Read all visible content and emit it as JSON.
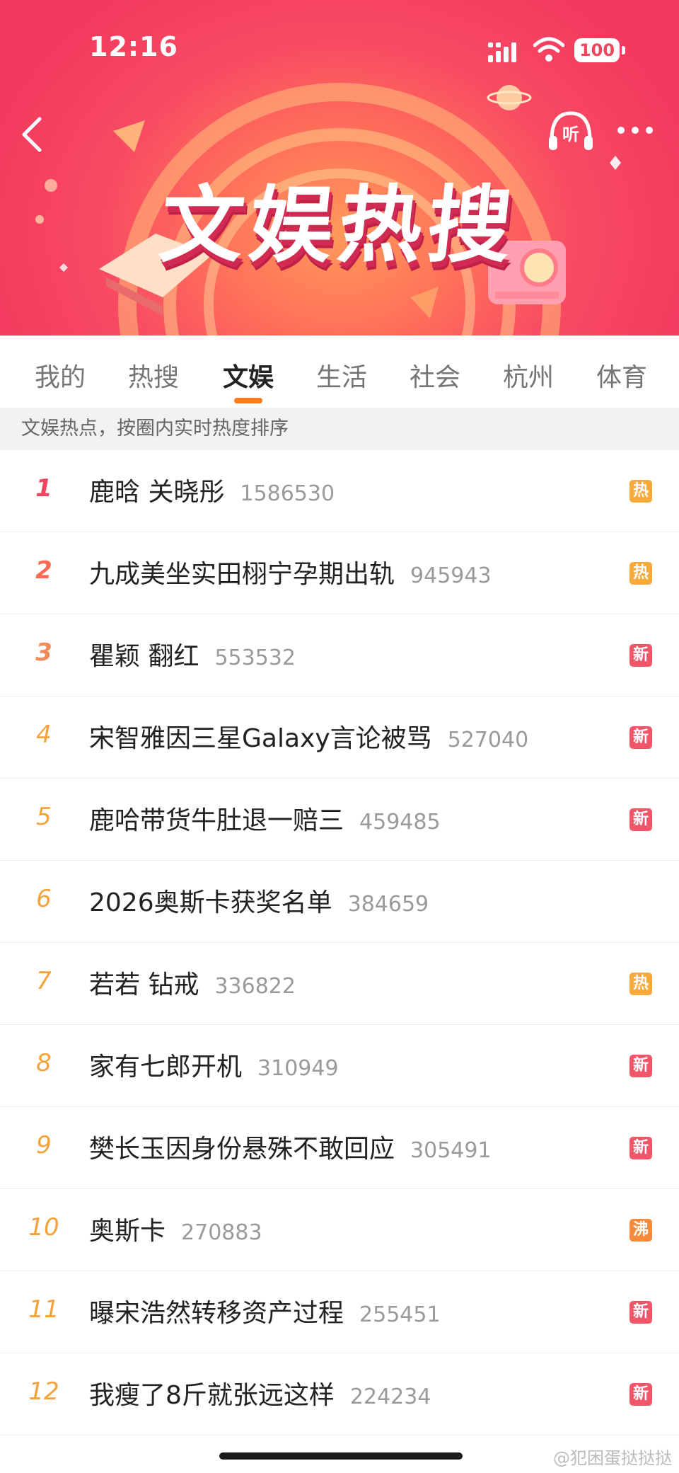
{
  "status_bar": {
    "time": "12:16",
    "battery": "100"
  },
  "header": {
    "title": "文娱热搜",
    "listen_label": "听"
  },
  "tabs": [
    {
      "label": "我的"
    },
    {
      "label": "热搜"
    },
    {
      "label": "文娱"
    },
    {
      "label": "生活"
    },
    {
      "label": "社会"
    },
    {
      "label": "杭州"
    },
    {
      "label": "体育"
    }
  ],
  "active_tab": "文娱",
  "subtitle": "文娱热点，按圈内实时热度排序",
  "items": [
    {
      "rank": "1",
      "title": "鹿晗 关晓彤",
      "count": "1586530",
      "badge": "热"
    },
    {
      "rank": "2",
      "title": "九成美坐实田栩宁孕期出轨",
      "count": "945943",
      "badge": "热"
    },
    {
      "rank": "3",
      "title": "瞿颖 翻红",
      "count": "553532",
      "badge": "新"
    },
    {
      "rank": "4",
      "title": "宋智雅因三星Galaxy言论被骂",
      "count": "527040",
      "badge": "新"
    },
    {
      "rank": "5",
      "title": "鹿哈带货牛肚退一赔三",
      "count": "459485",
      "badge": "新"
    },
    {
      "rank": "6",
      "title": "2026奥斯卡获奖名单",
      "count": "384659",
      "badge": ""
    },
    {
      "rank": "7",
      "title": "若若 钻戒",
      "count": "336822",
      "badge": "热"
    },
    {
      "rank": "8",
      "title": "家有七郎开机",
      "count": "310949",
      "badge": "新"
    },
    {
      "rank": "9",
      "title": "樊长玉因身份悬殊不敢回应",
      "count": "305491",
      "badge": "新"
    },
    {
      "rank": "10",
      "title": "奥斯卡",
      "count": "270883",
      "badge": "沸"
    },
    {
      "rank": "11",
      "title": "曝宋浩然转移资产过程",
      "count": "255451",
      "badge": "新"
    },
    {
      "rank": "12",
      "title": "我瘦了8斤就张远这样",
      "count": "224234",
      "badge": "新"
    }
  ],
  "watermark": "@犯困蛋挞挞挞",
  "colors": {
    "accent": "#ff7a1a",
    "hot": "#f7a93a",
    "new": "#f0566a",
    "boil": "#f68a3c"
  }
}
